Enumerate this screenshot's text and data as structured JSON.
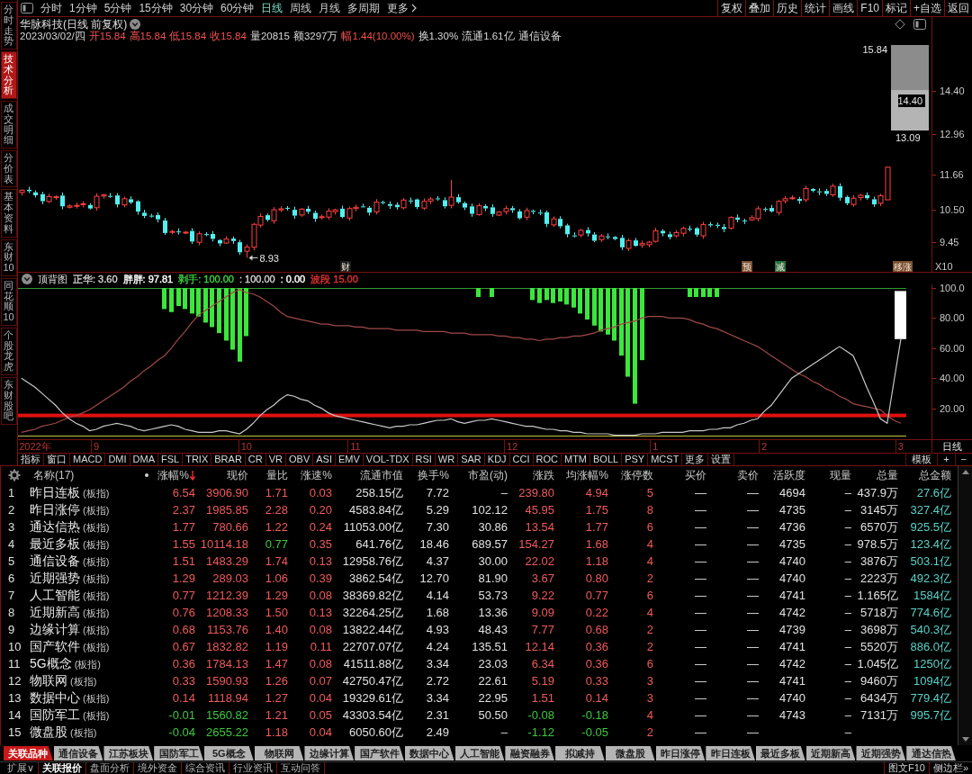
{
  "sidebar": {
    "tabs": [
      {
        "label": "分时走势",
        "selected": false
      },
      {
        "label": "技术分析",
        "selected": true
      },
      {
        "label": "成交明细",
        "selected": false
      },
      {
        "label": "分价表",
        "selected": false
      },
      {
        "label": "基本资料",
        "selected": false
      },
      {
        "label": "东财10",
        "selected": false
      },
      {
        "label": "同花顺10",
        "selected": false
      },
      {
        "label": "个股龙虎",
        "selected": false
      },
      {
        "label": "东财股吧",
        "selected": false
      }
    ]
  },
  "toolbar": {
    "periods": [
      {
        "label": "分时",
        "selected": false
      },
      {
        "label": "1分钟",
        "selected": false
      },
      {
        "label": "5分钟",
        "selected": false
      },
      {
        "label": "15分钟",
        "selected": false
      },
      {
        "label": "30分钟",
        "selected": false
      },
      {
        "label": "60分钟",
        "selected": false
      },
      {
        "label": "日线",
        "selected": true
      },
      {
        "label": "周线",
        "selected": false
      },
      {
        "label": "月线",
        "selected": false
      },
      {
        "label": "多周期",
        "selected": false
      }
    ],
    "more": "更多",
    "actions": [
      "复权",
      "叠加",
      "历史",
      "统计",
      "画线",
      "F10",
      "标记",
      "+自选",
      "返回"
    ]
  },
  "quote": {
    "title": "华脉科技(日线 前复权)",
    "fields": [
      {
        "text": "2023/03/02/四",
        "rising": false
      },
      {
        "text": "开15.84",
        "rising": true
      },
      {
        "text": "高15.84",
        "rising": true
      },
      {
        "text": "低15.84",
        "rising": true
      },
      {
        "text": "收15.84",
        "rising": true
      },
      {
        "text": "量20815",
        "rising": false
      },
      {
        "text": "额3297万",
        "rising": false
      },
      {
        "text": "幅1.44(10.00%)",
        "rising": true
      },
      {
        "text": "换1.30%",
        "rising": false
      },
      {
        "text": "流通1.61亿",
        "rising": false
      },
      {
        "text": "通信设备",
        "rising": false
      }
    ]
  },
  "price_chart": {
    "range_labels": [
      "15.84",
      "14.40",
      "13.09"
    ],
    "low_label": "8.93",
    "events": [
      {
        "label": "财",
        "color": "#1c1c1c"
      },
      {
        "label": "预",
        "color": "#7a5030"
      },
      {
        "label": "减",
        "color": "#2a7040"
      },
      {
        "label": "移涨",
        "color": "#7a5030"
      }
    ],
    "axis_labels": [
      "14.40",
      "12.96",
      "11.66",
      "10.50",
      "9.45"
    ],
    "scale_label": "X10"
  },
  "indicator": {
    "name": "顶背图",
    "values": [
      {
        "text": "正华: 3.60",
        "color": "#d0d0d0"
      },
      {
        "text": "胖胖: 97.81",
        "color": "#ffffff"
      },
      {
        "text": "剥手: 100.00",
        "color": "#3cd03c"
      },
      {
        "text": ": 100.00",
        "color": "#d0d0d0"
      },
      {
        "text": ": 0.00",
        "color": "#ffffff"
      },
      {
        "text": "波段 15.00",
        "color": "#e03232"
      }
    ],
    "period_label": "日线",
    "chart_data": {
      "type": "line",
      "categories": [
        null,
        null,
        "2022年",
        null,
        null,
        null,
        null,
        null,
        null,
        null,
        null,
        "9",
        null,
        null,
        null,
        null,
        null,
        null,
        null,
        null,
        null,
        null,
        null,
        null,
        null,
        null,
        null,
        null,
        null,
        null,
        null,
        null,
        null,
        "10",
        null,
        null,
        null,
        null,
        null,
        null,
        null,
        null,
        null,
        null,
        null,
        null,
        null,
        null,
        null,
        "11",
        null,
        null,
        null,
        null,
        null,
        null,
        null,
        null,
        null,
        null,
        null,
        null,
        null,
        null,
        null,
        null,
        null,
        null,
        null,
        null,
        null,
        null,
        "12",
        null,
        null,
        null,
        null,
        null,
        null,
        null,
        null,
        null,
        null,
        null,
        null,
        null,
        null,
        null,
        null,
        null,
        null,
        null,
        null,
        "1",
        null,
        null,
        null,
        null,
        null,
        null,
        null,
        null,
        null,
        null,
        null,
        null,
        null,
        null,
        null,
        "2",
        null,
        null,
        null,
        null,
        null,
        null,
        null,
        null,
        null,
        null,
        null,
        null,
        null,
        null,
        null,
        null,
        null,
        null,
        null,
        "3"
      ],
      "ylim": [
        -0.6,
        102.4
      ],
      "yticks": [
        {
          "value": 100,
          "label": "100.0"
        },
        {
          "value": 80,
          "label": "80.00"
        },
        {
          "value": 60,
          "label": "60.00"
        },
        {
          "value": 40,
          "label": "40.00"
        },
        {
          "value": 20,
          "label": "20.00"
        }
      ],
      "series": [
        {
          "type": "bar",
          "color": "#3ce63c",
          "base": [
            null,
            null,
            null,
            null,
            null,
            null,
            null,
            null,
            null,
            null,
            null,
            null,
            null,
            null,
            null,
            null,
            null,
            null,
            null,
            null,
            null,
            100,
            100,
            100,
            100,
            100,
            100,
            100,
            100,
            100,
            100,
            100,
            100,
            100,
            null,
            null,
            null,
            null,
            null,
            null,
            null,
            null,
            null,
            null,
            null,
            null,
            null,
            null,
            null,
            null,
            null,
            null,
            null,
            null,
            null,
            null,
            null,
            null,
            null,
            null,
            null,
            null,
            null,
            null,
            null,
            null,
            null,
            100,
            null,
            100,
            null,
            null,
            null,
            null,
            null,
            100,
            100,
            100,
            100,
            100,
            100,
            100,
            100,
            100,
            100,
            100,
            100,
            100,
            100,
            100,
            100,
            100,
            null,
            null,
            null,
            null,
            null,
            null,
            100,
            100,
            100,
            100,
            100,
            null,
            null,
            null,
            null,
            null,
            null,
            null,
            null,
            null,
            null,
            null,
            null,
            null,
            null,
            null,
            null,
            null,
            null,
            null,
            null,
            null,
            null,
            null,
            null,
            null,
            null,
            null
          ],
          "values": [
            null,
            null,
            null,
            null,
            null,
            null,
            null,
            null,
            null,
            null,
            null,
            null,
            null,
            null,
            null,
            null,
            null,
            null,
            null,
            null,
            null,
            -14,
            -16,
            -12,
            -14,
            -17,
            -19,
            -23,
            -26,
            -30,
            -35,
            -41,
            -49,
            -32,
            null,
            null,
            null,
            null,
            null,
            null,
            null,
            null,
            null,
            null,
            null,
            null,
            null,
            null,
            null,
            null,
            null,
            null,
            null,
            null,
            null,
            null,
            null,
            null,
            null,
            null,
            null,
            null,
            null,
            null,
            null,
            null,
            null,
            -6,
            null,
            -6,
            null,
            null,
            null,
            null,
            null,
            -8,
            -10,
            -8,
            -10,
            -9,
            -11,
            -13,
            -17,
            -21,
            -25,
            -29,
            -31,
            -35,
            -45,
            -59,
            -77,
            -48,
            null,
            null,
            null,
            null,
            null,
            null,
            -6,
            -6,
            -6,
            -6,
            -6,
            null,
            null,
            null,
            null,
            null,
            null,
            null,
            null,
            null,
            null,
            null,
            null,
            null,
            null,
            null,
            null,
            null,
            null,
            null,
            null,
            null,
            null,
            null,
            null,
            null,
            null,
            null
          ]
        },
        {
          "type": "line",
          "color": "#a04848",
          "values": [
            4,
            5,
            6,
            8,
            9,
            10,
            12,
            14,
            15,
            17,
            19,
            22,
            25,
            28,
            31,
            34,
            38,
            41,
            45,
            48,
            52,
            55,
            60,
            66,
            71,
            77,
            82,
            85,
            88,
            91,
            94,
            97,
            99,
            97,
            96,
            94,
            91,
            88,
            84,
            81,
            80,
            79,
            78,
            77,
            76,
            76,
            75,
            75,
            75,
            74,
            74,
            73,
            73,
            73,
            73,
            72,
            72,
            72,
            72,
            71,
            71,
            71,
            71,
            70,
            70,
            70,
            69,
            69,
            69,
            69,
            68,
            68,
            67,
            67,
            66,
            66,
            65,
            66,
            66,
            67,
            67,
            68,
            68,
            69,
            70,
            72,
            73,
            74,
            76,
            77,
            78,
            80,
            81,
            81,
            81,
            80,
            80,
            80,
            79,
            77,
            76,
            74,
            73,
            71,
            69,
            67,
            65,
            63,
            61,
            58,
            55,
            52,
            49,
            46,
            43,
            41,
            38,
            36,
            33,
            31,
            28,
            26,
            23,
            22,
            21,
            20,
            19,
            15,
            12,
            10
          ]
        },
        {
          "type": "line",
          "color": "#c8c8c8",
          "values": [
            40,
            37,
            34,
            30,
            26,
            22,
            17,
            13,
            10,
            8,
            5,
            6,
            8,
            9,
            10,
            9,
            8,
            6,
            5,
            6,
            7,
            8,
            9,
            8,
            6,
            5,
            4,
            4,
            4,
            5,
            5,
            4,
            3,
            6,
            10,
            15,
            19,
            22,
            26,
            29,
            28,
            26,
            25,
            22,
            20,
            17,
            15,
            14,
            13,
            12,
            11,
            10,
            9,
            8,
            7,
            8,
            8,
            9,
            9,
            10,
            11,
            12,
            12,
            13,
            11,
            10,
            11,
            12,
            12,
            13,
            12,
            11,
            10,
            9,
            8,
            8,
            7,
            6,
            6,
            5,
            5,
            4,
            4,
            3,
            3,
            3,
            3,
            2,
            2,
            2,
            2,
            3,
            3,
            3,
            4,
            4,
            4,
            4,
            5,
            5,
            5,
            6,
            6,
            7,
            7,
            9,
            10,
            12,
            13,
            18,
            22,
            28,
            34,
            40,
            43,
            46,
            49,
            52,
            55,
            58,
            61,
            58,
            55,
            45,
            34,
            24,
            13,
            10,
            38,
            66
          ]
        },
        {
          "type": "bar",
          "color": "#ffffff",
          "base": [
            null,
            null,
            null,
            null,
            null,
            null,
            null,
            null,
            null,
            null,
            null,
            null,
            null,
            null,
            null,
            null,
            null,
            null,
            null,
            null,
            null,
            null,
            null,
            null,
            null,
            null,
            null,
            null,
            null,
            null,
            null,
            null,
            null,
            null,
            null,
            null,
            null,
            null,
            null,
            null,
            null,
            null,
            null,
            null,
            null,
            null,
            null,
            null,
            null,
            null,
            null,
            null,
            null,
            null,
            null,
            null,
            null,
            null,
            null,
            null,
            null,
            null,
            null,
            null,
            null,
            null,
            null,
            null,
            null,
            null,
            null,
            null,
            null,
            null,
            null,
            null,
            null,
            null,
            null,
            null,
            null,
            null,
            null,
            null,
            null,
            null,
            null,
            null,
            null,
            null,
            null,
            null,
            null,
            null,
            null,
            null,
            null,
            null,
            null,
            null,
            null,
            null,
            null,
            null,
            null,
            null,
            null,
            null,
            null,
            null,
            null,
            null,
            null,
            null,
            null,
            null,
            null,
            null,
            null,
            null,
            null,
            null,
            null,
            null,
            null,
            null,
            null,
            null,
            null,
            98
          ],
          "values": [
            null,
            null,
            null,
            null,
            null,
            null,
            null,
            null,
            null,
            null,
            null,
            null,
            null,
            null,
            null,
            null,
            null,
            null,
            null,
            null,
            null,
            null,
            null,
            null,
            null,
            null,
            null,
            null,
            null,
            null,
            null,
            null,
            null,
            null,
            null,
            null,
            null,
            null,
            null,
            null,
            null,
            null,
            null,
            null,
            null,
            null,
            null,
            null,
            null,
            null,
            null,
            null,
            null,
            null,
            null,
            null,
            null,
            null,
            null,
            null,
            null,
            null,
            null,
            null,
            null,
            null,
            null,
            null,
            null,
            null,
            null,
            null,
            null,
            null,
            null,
            null,
            null,
            null,
            null,
            null,
            null,
            null,
            null,
            null,
            null,
            null,
            null,
            null,
            null,
            null,
            null,
            null,
            null,
            null,
            null,
            null,
            null,
            null,
            null,
            null,
            null,
            null,
            null,
            null,
            null,
            null,
            null,
            null,
            null,
            null,
            null,
            null,
            null,
            null,
            null,
            null,
            null,
            null,
            null,
            null,
            null,
            null,
            null,
            null,
            null,
            null,
            null,
            null,
            null,
            -32
          ]
        }
      ],
      "ref_lines": [
        {
          "axis": "y",
          "value": 100,
          "color": "#2f9a2f"
        },
        {
          "axis": "y",
          "value": 2,
          "color": "#c8c040"
        }
      ],
      "bands": [
        {
          "axis": "y",
          "from": 14,
          "to": 16.4,
          "color": "#e01010"
        }
      ]
    }
  },
  "indicator_tabs": {
    "items": [
      "指标",
      "窗口",
      "MACD",
      "DMI",
      "DMA",
      "FSL",
      "TRIX",
      "BRAR",
      "CR",
      "VR",
      "OBV",
      "ASI",
      "EMV",
      "VOL-TDX",
      "RSI",
      "WR",
      "SAR",
      "KDJ",
      "CCI",
      "ROC",
      "MTM",
      "BOLL",
      "PSY",
      "MCST",
      "更多",
      "设置"
    ],
    "right": [
      "模板",
      "+",
      "−"
    ]
  },
  "table": {
    "name_header": "名称(17)",
    "columns": [
      {
        "label": "涨幅%",
        "kind": "trend",
        "sorted": true
      },
      {
        "label": "现价",
        "kind": "trend",
        "sorted": false
      },
      {
        "label": "量比",
        "kind": "ratio",
        "sorted": false
      },
      {
        "label": "涨速%",
        "kind": "rise",
        "sorted": false
      },
      {
        "label": "流通市值",
        "kind": "plain",
        "sorted": false
      },
      {
        "label": "换手%",
        "kind": "plain",
        "sorted": false
      },
      {
        "label": "市盈(动)",
        "kind": "plain",
        "sorted": false
      },
      {
        "label": "涨跌",
        "kind": "trend",
        "sorted": false
      },
      {
        "label": "均涨幅%",
        "kind": "trend",
        "sorted": false
      },
      {
        "label": "涨停数",
        "kind": "rise",
        "sorted": false
      },
      {
        "label": "买价",
        "kind": "plain",
        "sorted": false
      },
      {
        "label": "卖价",
        "kind": "plain",
        "sorted": false
      },
      {
        "label": "活跃度",
        "kind": "plain",
        "sorted": false
      },
      {
        "label": "现量",
        "kind": "plain",
        "sorted": false
      },
      {
        "label": "总量",
        "kind": "plain",
        "sorted": false
      },
      {
        "label": "总金额",
        "kind": "amount",
        "sorted": false
      }
    ],
    "rows": [
      {
        "index": "1",
        "name": "昨日连板",
        "tag": "(板指)",
        "rising": true,
        "ratio_high": true,
        "cells": [
          "6.54",
          "3906.90",
          "1.71",
          "0.03",
          "258.15亿",
          "7.72",
          "–",
          "239.80",
          "4.94",
          "5",
          "—",
          "—",
          "4694",
          "–",
          "437.9万",
          "27.6亿"
        ]
      },
      {
        "index": "2",
        "name": "昨日涨停",
        "tag": "(板指)",
        "rising": true,
        "ratio_high": true,
        "cells": [
          "2.37",
          "1985.85",
          "2.28",
          "0.20",
          "4583.84亿",
          "5.29",
          "102.12",
          "45.95",
          "1.75",
          "8",
          "—",
          "—",
          "4735",
          "–",
          "3145万",
          "327.4亿"
        ]
      },
      {
        "index": "3",
        "name": "通达信热",
        "tag": "(板指)",
        "rising": true,
        "ratio_high": true,
        "cells": [
          "1.77",
          "780.66",
          "1.22",
          "0.24",
          "11053.00亿",
          "7.30",
          "30.86",
          "13.54",
          "1.77",
          "6",
          "—",
          "—",
          "4736",
          "–",
          "6570万",
          "925.5亿"
        ]
      },
      {
        "index": "4",
        "name": "最近多板",
        "tag": "(板指)",
        "rising": true,
        "ratio_high": false,
        "cells": [
          "1.55",
          "10114.18",
          "0.77",
          "0.35",
          "641.76亿",
          "18.46",
          "689.57",
          "154.27",
          "1.68",
          "4",
          "—",
          "—",
          "4735",
          "–",
          "978.5万",
          "123.4亿"
        ]
      },
      {
        "index": "5",
        "name": "通信设备",
        "tag": "(板指)",
        "rising": true,
        "ratio_high": true,
        "cells": [
          "1.51",
          "1483.29",
          "1.74",
          "0.13",
          "12958.76亿",
          "4.37",
          "30.00",
          "22.02",
          "1.18",
          "4",
          "—",
          "—",
          "4740",
          "–",
          "3876万",
          "503.1亿"
        ]
      },
      {
        "index": "6",
        "name": "近期强势",
        "tag": "(板指)",
        "rising": true,
        "ratio_high": true,
        "cells": [
          "1.29",
          "289.03",
          "1.06",
          "0.39",
          "3862.54亿",
          "12.70",
          "81.90",
          "3.67",
          "0.80",
          "2",
          "—",
          "—",
          "4740",
          "–",
          "2223万",
          "492.3亿"
        ]
      },
      {
        "index": "7",
        "name": "人工智能",
        "tag": "(板指)",
        "rising": true,
        "ratio_high": true,
        "cells": [
          "0.77",
          "1212.39",
          "1.29",
          "0.08",
          "38369.82亿",
          "4.14",
          "53.73",
          "9.22",
          "0.77",
          "6",
          "—",
          "—",
          "4741",
          "–",
          "1.165亿",
          "1584亿"
        ]
      },
      {
        "index": "8",
        "name": "近期新高",
        "tag": "(板指)",
        "rising": true,
        "ratio_high": true,
        "cells": [
          "0.76",
          "1208.33",
          "1.50",
          "0.13",
          "32264.25亿",
          "1.68",
          "13.36",
          "9.09",
          "0.22",
          "4",
          "—",
          "—",
          "4742",
          "–",
          "5718万",
          "774.6亿"
        ]
      },
      {
        "index": "9",
        "name": "边缘计算",
        "tag": "(板指)",
        "rising": true,
        "ratio_high": true,
        "cells": [
          "0.68",
          "1153.76",
          "1.40",
          "0.08",
          "13822.44亿",
          "4.93",
          "48.43",
          "7.77",
          "0.68",
          "2",
          "—",
          "—",
          "4739",
          "–",
          "3698万",
          "540.3亿"
        ]
      },
      {
        "index": "10",
        "name": "国产软件",
        "tag": "(板指)",
        "rising": true,
        "ratio_high": true,
        "cells": [
          "0.67",
          "1832.82",
          "1.19",
          "0.11",
          "22707.07亿",
          "4.24",
          "135.51",
          "12.14",
          "0.36",
          "2",
          "—",
          "—",
          "4741",
          "–",
          "5520万",
          "886.0亿"
        ]
      },
      {
        "index": "11",
        "name": "5G概念",
        "tag": "(板指)",
        "rising": true,
        "ratio_high": true,
        "cells": [
          "0.36",
          "1784.13",
          "1.47",
          "0.08",
          "41511.88亿",
          "3.34",
          "23.03",
          "6.34",
          "0.36",
          "6",
          "—",
          "—",
          "4742",
          "–",
          "1.045亿",
          "1250亿"
        ]
      },
      {
        "index": "12",
        "name": "物联网",
        "tag": "(板指)",
        "rising": true,
        "ratio_high": true,
        "cells": [
          "0.33",
          "1590.93",
          "1.26",
          "0.07",
          "42750.47亿",
          "2.72",
          "22.61",
          "5.19",
          "0.33",
          "3",
          "—",
          "—",
          "4741",
          "–",
          "9460万",
          "1094亿"
        ]
      },
      {
        "index": "13",
        "name": "数据中心",
        "tag": "(板指)",
        "rising": true,
        "ratio_high": true,
        "cells": [
          "0.14",
          "1118.94",
          "1.27",
          "0.04",
          "19329.61亿",
          "3.34",
          "22.95",
          "1.51",
          "0.14",
          "3",
          "—",
          "—",
          "4740",
          "–",
          "6434万",
          "779.4亿"
        ]
      },
      {
        "index": "14",
        "name": "国防军工",
        "tag": "(板指)",
        "rising": false,
        "ratio_high": true,
        "cells": [
          "-0.01",
          "1560.82",
          "1.21",
          "0.05",
          "43303.54亿",
          "2.31",
          "50.50",
          "-0.08",
          "-0.18",
          "4",
          "—",
          "—",
          "4743",
          "–",
          "7131万",
          "995.7亿"
        ]
      },
      {
        "index": "15",
        "name": "微盘股",
        "tag": "(板指)",
        "rising": false,
        "ratio_high": true,
        "cells": [
          "-0.04",
          "2655.22",
          "1.18",
          "0.04",
          "6050.60亿",
          "2.49",
          "–",
          "-1.12",
          "-0.05",
          "2",
          "—",
          "—",
          null,
          "–",
          null,
          null
        ]
      }
    ]
  },
  "sector_tabs": [
    {
      "label": "关联品种",
      "selected": true
    },
    {
      "label": "通信设备",
      "selected": false
    },
    {
      "label": "江苏板块",
      "selected": false
    },
    {
      "label": "国防军工",
      "selected": false
    },
    {
      "label": "5G概念",
      "selected": false
    },
    {
      "label": "物联网",
      "selected": false
    },
    {
      "label": "边缘计算",
      "selected": false
    },
    {
      "label": "国产软件",
      "selected": false
    },
    {
      "label": "数据中心",
      "selected": false
    },
    {
      "label": "人工智能",
      "selected": false
    },
    {
      "label": "融资融券",
      "selected": false
    },
    {
      "label": "拟减持",
      "selected": false
    },
    {
      "label": "微盘股",
      "selected": false
    },
    {
      "label": "昨日涨停",
      "selected": false
    },
    {
      "label": "昨日连板",
      "selected": false
    },
    {
      "label": "最近多板",
      "selected": false
    },
    {
      "label": "近期新高",
      "selected": false
    },
    {
      "label": "近期强势",
      "selected": false
    },
    {
      "label": "通达信热",
      "selected": false
    }
  ],
  "bottom_bar": {
    "tabs": [
      {
        "label": "扩展∨",
        "selected": false
      },
      {
        "label": "关联报价",
        "selected": true
      },
      {
        "label": "盘面分析",
        "selected": false
      },
      {
        "label": "境外资金",
        "selected": false
      },
      {
        "label": "综合资讯",
        "selected": false
      },
      {
        "label": "行业资讯",
        "selected": false
      },
      {
        "label": "互动问答",
        "selected": false
      }
    ],
    "right": [
      "图文F10",
      "侧边栏»"
    ]
  }
}
